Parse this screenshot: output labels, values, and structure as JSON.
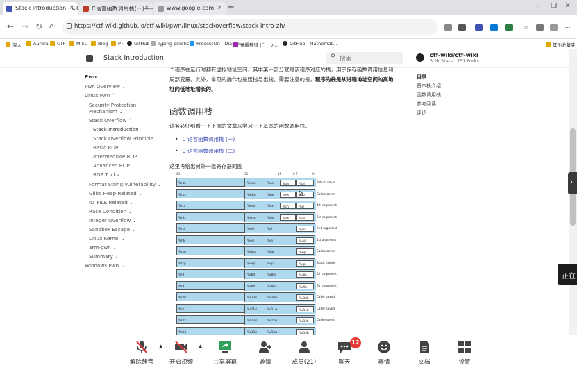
{
  "browser": {
    "tabs": [
      {
        "title": "Stack Introduction - CTF Wiki",
        "active": true
      },
      {
        "title": "C语言函数调用栈(一)——堆和栈的区别",
        "active": false
      },
      {
        "title": "www.google.com",
        "active": false
      }
    ],
    "new_tab_label": "+",
    "window_controls": {
      "minimize": "–",
      "restore": "❐",
      "close": "✕"
    },
    "url": "https://ctf-wiki.github.io/ctf-wiki/pwn/linux/stackoverflow/stack-intro-zh/",
    "bookmarks": [
      "深大",
      "Aurora",
      "CTF",
      "MISC",
      "Blog",
      "PT",
      "GitHub",
      "Typing practice",
      "ProcessOn - Diagra...",
      "御曜神道 | ゛ つ-...",
      "GitHub - Mathemat..."
    ],
    "other_bookmarks": "其他收藏夹",
    "colors": {
      "accent": "#3f51b5",
      "tabbar": "#dfe1e5"
    }
  },
  "site": {
    "title": "Stack Introduction",
    "search_placeholder": "搜索",
    "repo": "ctf-wiki/ctf-wiki",
    "stars": "3.2k Stars · 751 Forks"
  },
  "sidebar": {
    "section": "Pwn",
    "items": [
      "Pwn Overview ⌄",
      "Linux Pwn ⌃",
      "Security Protection",
      "Mechanism ⌄",
      "Stack Overflow ⌃",
      "Stack Introduction",
      "Stack Overflow Principle",
      "Basic ROP",
      "Intermediate ROP",
      "Advanced ROP",
      "ROP Tricks",
      "Format String Vulnerability ⌄",
      "Glibc Heap Related ⌄",
      "IO_FILE Related ⌄",
      "Race Condition ⌄",
      "Integer Overflow ⌄",
      "Sandbox Escape ⌄",
      "Linux Kernel ⌄",
      "arm-pwn ⌄",
      "Summary ⌄",
      "Windows Pwn ⌄"
    ]
  },
  "article": {
    "intro_line1": "个程序在运行时都有虚拟地址空间，其中某一部分就是该程序对应的栈，用于保存函数调用信息和",
    "intro_line2_plain": "局部变量。此外，常见的操作也是压栈与出栈。需要注意的是，",
    "intro_line2_bold": "程序的栈是从进程地址空间的高地",
    "intro_line3_bold": "址向低地址增长的",
    "intro_line3_end": "。",
    "heading": "函数调用栈",
    "para": "请务必仔细看一下下面的文章来学习一下基本的函数调用栈。",
    "links": [
      "C 语言函数调用栈 (一)",
      "C 语言函数调用栈 (二)"
    ],
    "para2": "这里再给出另外一张寄存器的图",
    "bit_header": {
      "b63": "63",
      "b31": "31",
      "b15": "15",
      "b87": "8 7",
      "b0": "0"
    },
    "registers": [
      {
        "r64": "%rax",
        "r32": "%eax",
        "r16": "%ax",
        "r8a": "%ah",
        "r8": "%al",
        "use": "Return value"
      },
      {
        "r64": "%rbx",
        "r32": "%ebx",
        "r16": "%bx",
        "r8a": "%bh",
        "r8": "%bl",
        "use": "Callee saved"
      },
      {
        "r64": "%rcx",
        "r32": "%ecx",
        "r16": "%cx",
        "r8a": "%ch",
        "r8": "%cl",
        "use": "4th argument"
      },
      {
        "r64": "%rdx",
        "r32": "%edx",
        "r16": "%dx",
        "r8a": "%dh",
        "r8": "%dl",
        "use": "3rd argument"
      },
      {
        "r64": "%rsi",
        "r32": "%esi",
        "r16": "%si",
        "r8a": "",
        "r8": "%sil",
        "use": "2nd argument"
      },
      {
        "r64": "%rdi",
        "r32": "%edi",
        "r16": "%di",
        "r8a": "",
        "r8": "%dil",
        "use": "1st argument"
      },
      {
        "r64": "%rbp",
        "r32": "%ebp",
        "r16": "%bp",
        "r8a": "",
        "r8": "%bpl",
        "use": "Callee saved"
      },
      {
        "r64": "%rsp",
        "r32": "%esp",
        "r16": "%sp",
        "r8a": "",
        "r8": "%spl",
        "use": "Stack pointer"
      },
      {
        "r64": "%r8",
        "r32": "%r8d",
        "r16": "%r8w",
        "r8a": "",
        "r8": "%r8b",
        "use": "5th argument"
      },
      {
        "r64": "%r9",
        "r32": "%r9d",
        "r16": "%r9w",
        "r8a": "",
        "r8": "%r9b",
        "use": "6th argument"
      },
      {
        "r64": "%r10",
        "r32": "%r10d",
        "r16": "%r10w",
        "r8a": "",
        "r8": "%r10b",
        "use": "Caller saved"
      },
      {
        "r64": "%r11",
        "r32": "%r11d",
        "r16": "%r11w",
        "r8a": "",
        "r8": "%r11b",
        "use": "Caller saved"
      },
      {
        "r64": "%r12",
        "r32": "%r12d",
        "r16": "%r12w",
        "r8a": "",
        "r8": "%r12b",
        "use": "Callee saved"
      },
      {
        "r64": "%r13",
        "r32": "%r13d",
        "r16": "%r13w",
        "r8a": "",
        "r8": "%r13b",
        "use": ""
      }
    ]
  },
  "toc": {
    "title": "目录",
    "items": [
      "基本栈介绍",
      "函数调用栈",
      "参考阅读",
      "评论"
    ]
  },
  "overlay": {
    "toast": "正在"
  },
  "meeting": {
    "buttons": [
      {
        "label": "解除静音",
        "icon": "muted-mic-icon"
      },
      {
        "label": "开启视频",
        "icon": "video-off-icon"
      },
      {
        "label": "共享屏幕",
        "icon": "share-screen-icon"
      },
      {
        "label": "邀请",
        "icon": "invite-icon"
      },
      {
        "label": "成员(21)",
        "icon": "members-icon"
      },
      {
        "label": "聊天",
        "icon": "chat-icon"
      },
      {
        "label": "表情",
        "icon": "emoji-icon"
      },
      {
        "label": "文档",
        "icon": "document-icon"
      },
      {
        "label": "设置",
        "icon": "settings-icon"
      }
    ],
    "chat_badge": "12"
  }
}
